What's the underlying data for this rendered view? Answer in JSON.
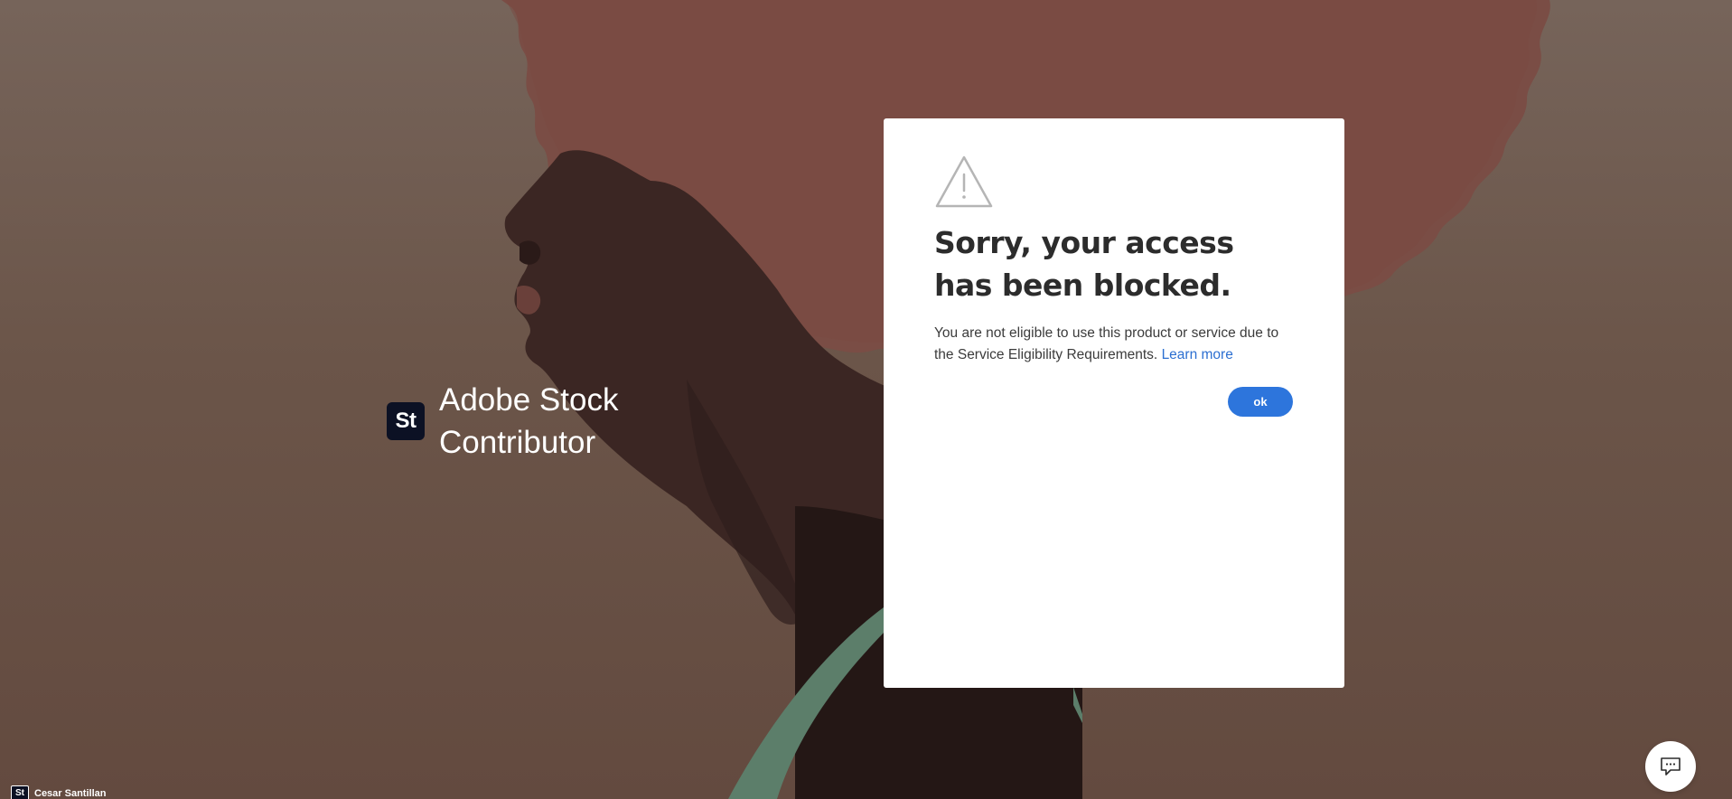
{
  "brand": {
    "logo_text": "St",
    "name": "Adobe Stock Contributor"
  },
  "dialog": {
    "icon": "alert-triangle-icon",
    "title": "Sorry, your access has been blocked.",
    "body": "You are not eligible to use this product or service due to the Service Eligibility Requirements.",
    "link_label": "Learn more",
    "ok_label": "ok"
  },
  "footer": {
    "logo_text": "St",
    "user_name": "Cesar Santillan"
  },
  "chat": {
    "icon": "chat-bubble-icon"
  },
  "colors": {
    "accent": "#2d75dc",
    "link": "#2c6fd1",
    "logo_bg": "#0c1124"
  }
}
